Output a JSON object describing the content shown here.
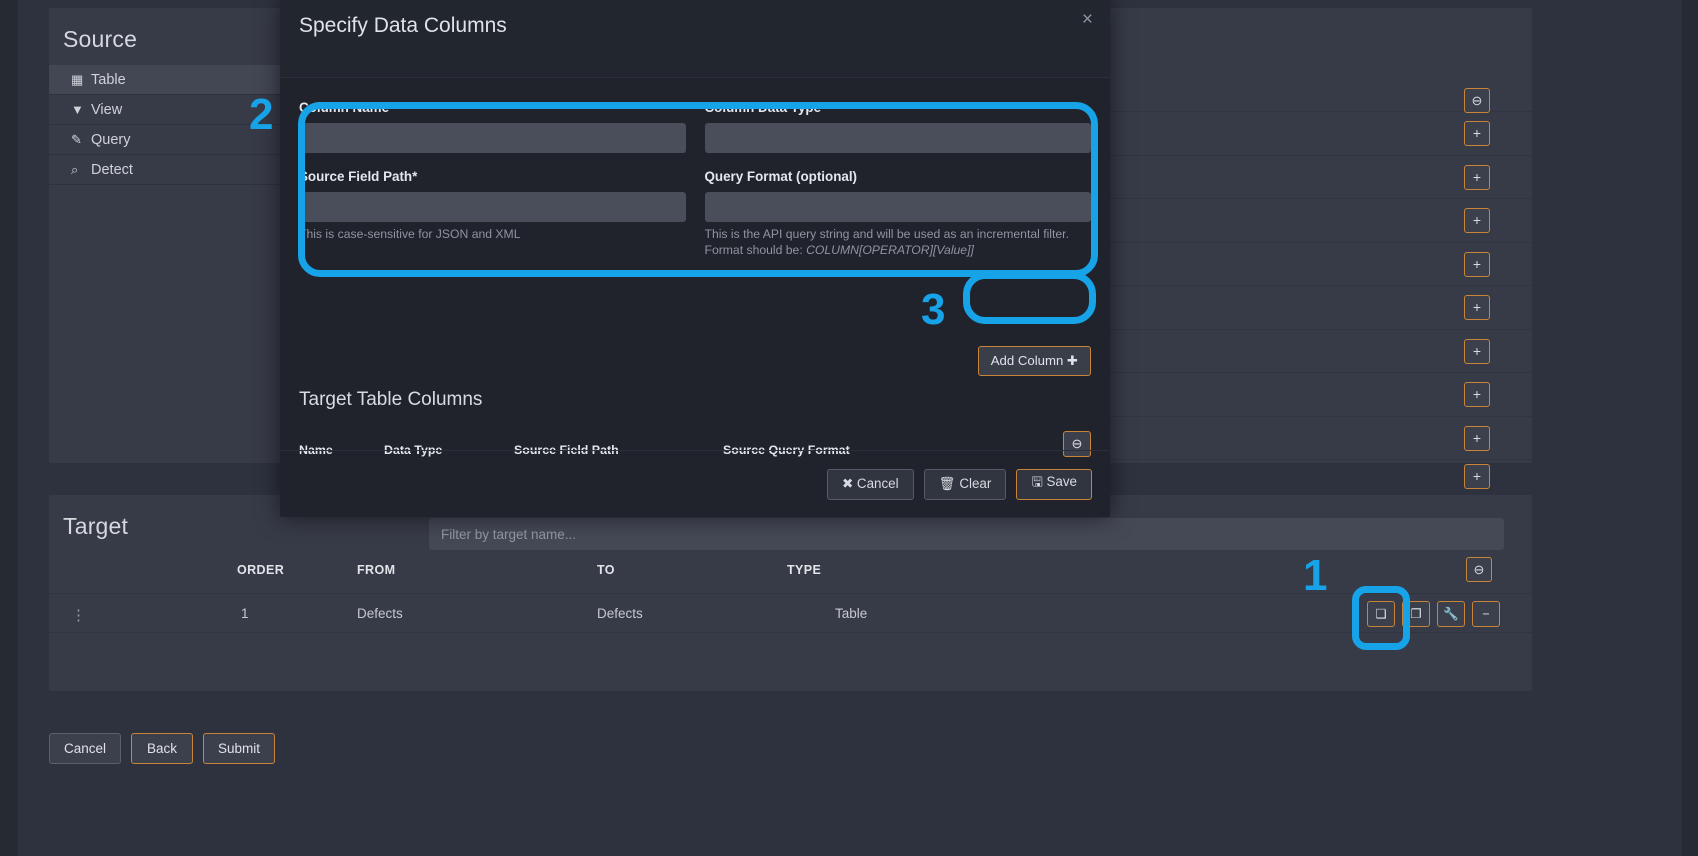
{
  "source": {
    "title": "Source",
    "items": [
      {
        "label": "Table",
        "icon": "table-grid-icon",
        "glyph": "▦",
        "active": true
      },
      {
        "label": "View",
        "icon": "filter-icon",
        "glyph": "▼",
        "active": false
      },
      {
        "label": "Query",
        "icon": "edit-square-icon",
        "glyph": "✎",
        "active": false
      },
      {
        "label": "Detect",
        "icon": "magnifier-icon",
        "glyph": "⌕",
        "active": false
      }
    ],
    "row_buttons": [
      "⊖",
      "+",
      "+",
      "+",
      "+",
      "+",
      "+",
      "+",
      "+",
      "+"
    ]
  },
  "target": {
    "title": "Target",
    "filter_placeholder": "Filter by target name...",
    "columns": [
      "ORDER",
      "FROM",
      "TO",
      "TYPE"
    ],
    "remove_all_label": "⊖",
    "rows": [
      {
        "order": "1",
        "from": "Defects",
        "to": "Defects",
        "type": "Table",
        "actions": [
          "columns-icon",
          "copy-icon",
          "wrench-icon",
          "minus-icon"
        ],
        "action_glyphs": [
          "❏",
          "❐",
          "🔧",
          "−"
        ]
      }
    ]
  },
  "bottom_bar": {
    "cancel": "Cancel",
    "back": "Back",
    "submit": "Submit"
  },
  "modal": {
    "title": "Specify Data Columns",
    "close_glyph": "×",
    "fields": {
      "column_name": {
        "label": "Column Name*",
        "value": "",
        "placeholder": ""
      },
      "column_data_type": {
        "label": "Column Data Type*",
        "value": "",
        "placeholder": ""
      },
      "source_field_path": {
        "label": "Source Field Path*",
        "value": "",
        "placeholder": "",
        "help": "This is case-sensitive for JSON and XML"
      },
      "query_format": {
        "label": "Query Format (optional)",
        "value": "",
        "placeholder": "",
        "help_line1": "This is the API query string and will be used as an incremental filter.",
        "help_line2_prefix": "Format should be: ",
        "help_line2_code": "COLUMN[OPERATOR][Value]]"
      }
    },
    "add_column_label": "Add Column ✚",
    "target_table_columns": {
      "title": "Target Table Columns",
      "headers": [
        "Name",
        "Data Type",
        "Source Field Path",
        "Source Query Format"
      ],
      "remove_glyph": "⊖",
      "rows": []
    },
    "footer": {
      "cancel": "✖ Cancel",
      "clear": "🗑 Clear",
      "save": "🖫 Save"
    }
  },
  "annotations": {
    "accent_color": "#17a3e8",
    "markers": [
      {
        "num": "1",
        "target": "target-row-columns-button"
      },
      {
        "num": "2",
        "target": "modal-column-form"
      },
      {
        "num": "3",
        "target": "add-column-button"
      }
    ]
  }
}
